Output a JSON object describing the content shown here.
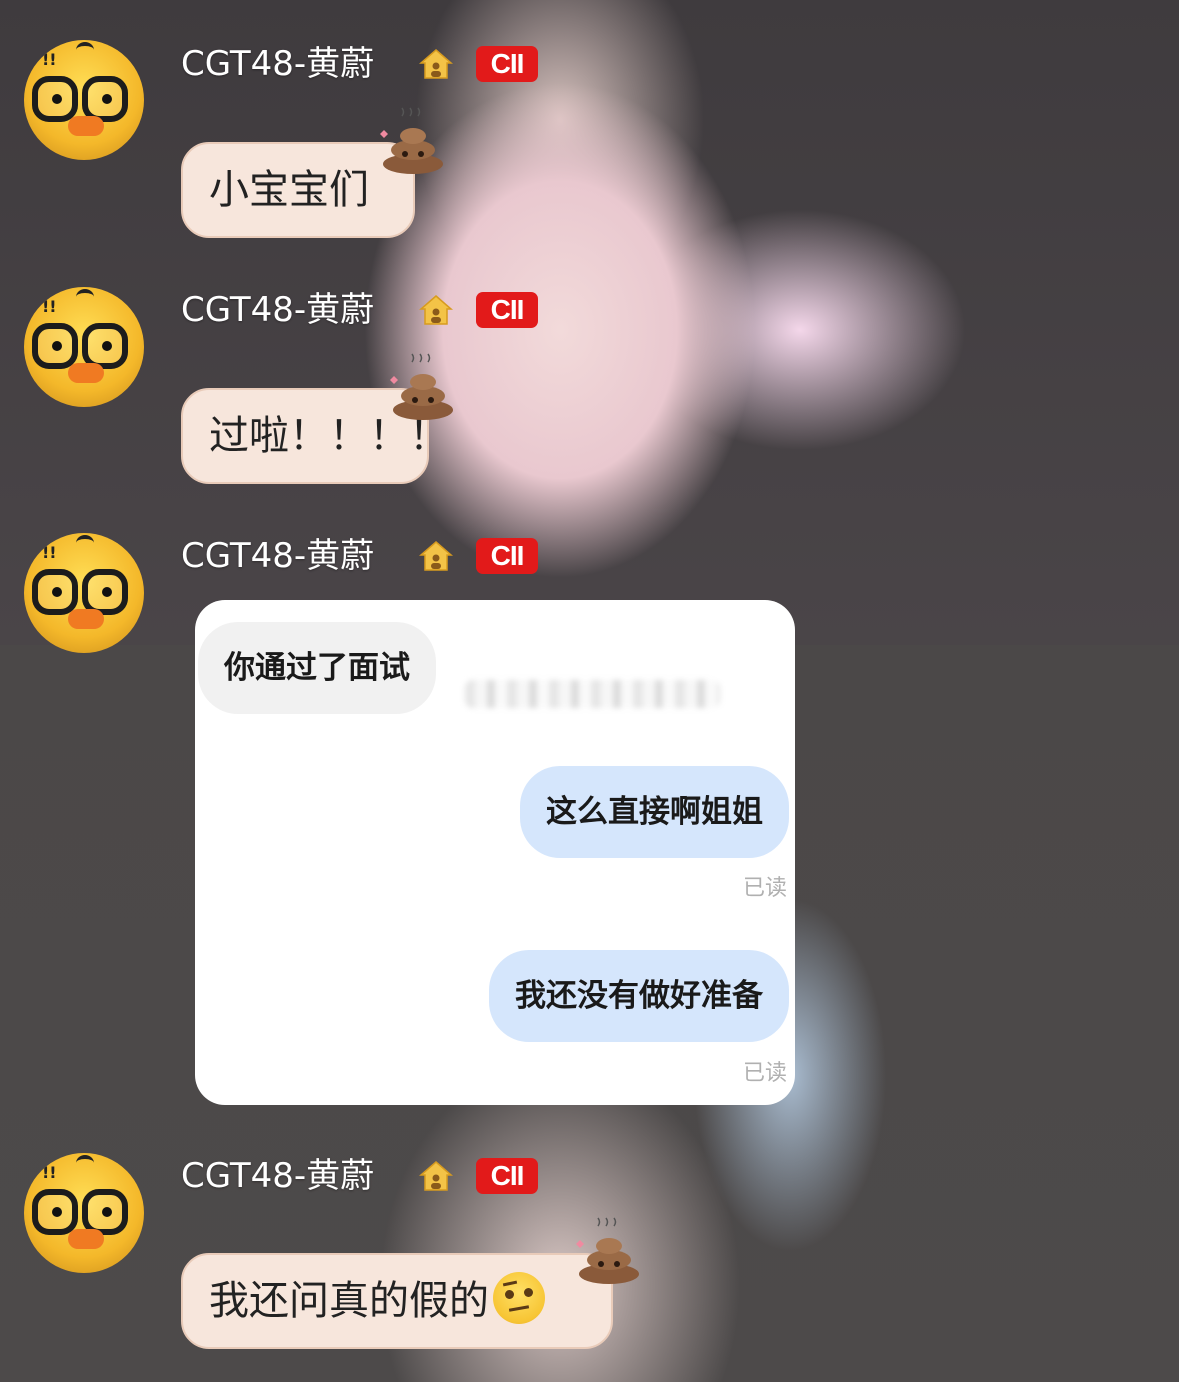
{
  "messages": [
    {
      "sender": "CGT48-黄蔚",
      "badge": "CII",
      "text": "小宝宝们"
    },
    {
      "sender": "CGT48-黄蔚",
      "badge": "CII",
      "text": "过啦！！！！"
    },
    {
      "sender": "CGT48-黄蔚",
      "badge": "CII"
    },
    {
      "sender": "CGT48-黄蔚",
      "badge": "CII",
      "text": "我还问真的假的"
    }
  ],
  "screenshot": {
    "incoming": "你通过了面试",
    "outgoing": [
      {
        "text": "这么直接啊姐姐",
        "status": "已读"
      },
      {
        "text": "我还没有做好准备",
        "status": "已读"
      }
    ]
  },
  "icons": {
    "avatar": "duck-with-glasses-avatar",
    "house": "house-icon",
    "bubble_decoration": "poop-icon",
    "emoji": "raised-eyebrow-emoji"
  },
  "colors": {
    "badge": "#e21a1a",
    "bubble": "#f7e6dc",
    "outgoing_bubble": "#d5e6fc",
    "incoming_bubble": "#f1f1f1"
  }
}
